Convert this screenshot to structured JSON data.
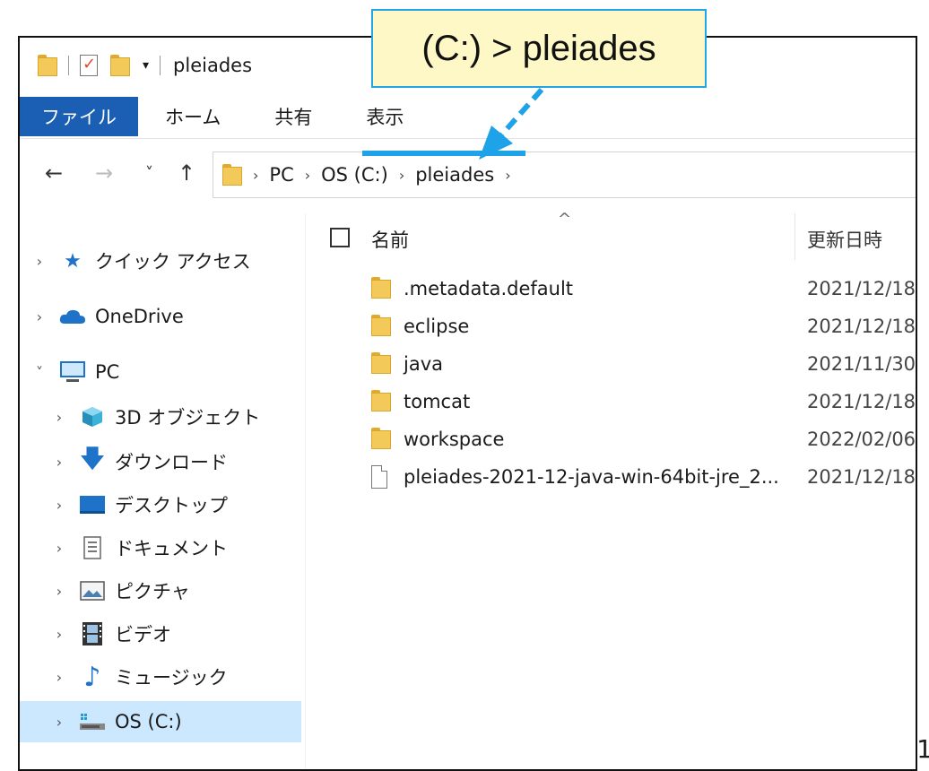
{
  "window": {
    "title": "pleiades"
  },
  "ribbon": {
    "tabs": [
      "ファイル",
      "ホーム",
      "共有",
      "表示"
    ]
  },
  "nav": {
    "back": "←",
    "forward": "→",
    "recent": "˅",
    "up": "↑"
  },
  "address": {
    "segments": [
      "PC",
      "OS (C:)",
      "pleiades"
    ]
  },
  "callout": {
    "text": "(C:) > pleiades"
  },
  "sidebar": {
    "items": [
      {
        "label": "クイック アクセス",
        "icon": "star-icon",
        "expanded": false
      },
      {
        "label": "OneDrive",
        "icon": "cloud-icon",
        "expanded": false
      },
      {
        "label": "PC",
        "icon": "computer-icon",
        "expanded": true
      },
      {
        "label": "3D オブジェクト",
        "icon": "cube-icon",
        "expanded": false
      },
      {
        "label": "ダウンロード",
        "icon": "download-icon",
        "expanded": false
      },
      {
        "label": "デスクトップ",
        "icon": "desktop-icon",
        "expanded": false
      },
      {
        "label": "ドキュメント",
        "icon": "document-icon",
        "expanded": false
      },
      {
        "label": "ピクチャ",
        "icon": "picture-icon",
        "expanded": false
      },
      {
        "label": "ビデオ",
        "icon": "video-icon",
        "expanded": false
      },
      {
        "label": "ミュージック",
        "icon": "music-icon",
        "expanded": false
      },
      {
        "label": "OS (C:)",
        "icon": "drive-icon",
        "expanded": false,
        "selected": true
      }
    ]
  },
  "list": {
    "columns": {
      "name": "名前",
      "date": "更新日時"
    },
    "rows": [
      {
        "name": ".metadata.default",
        "date": "2021/12/18",
        "type": "folder"
      },
      {
        "name": "eclipse",
        "date": "2021/12/18",
        "type": "folder"
      },
      {
        "name": "java",
        "date": "2021/11/30",
        "type": "folder"
      },
      {
        "name": "tomcat",
        "date": "2021/12/18",
        "type": "folder"
      },
      {
        "name": "workspace",
        "date": "2022/02/06",
        "type": "folder"
      },
      {
        "name": "pleiades-2021-12-java-win-64bit-jre_2...",
        "date": "2021/12/18",
        "type": "file"
      }
    ]
  },
  "colors": {
    "accent": "#1a5fb4",
    "highlight": "#1ea2e8",
    "selection": "#cce8ff",
    "callout_bg": "#fdf8c5"
  },
  "corner_glyph": "1"
}
